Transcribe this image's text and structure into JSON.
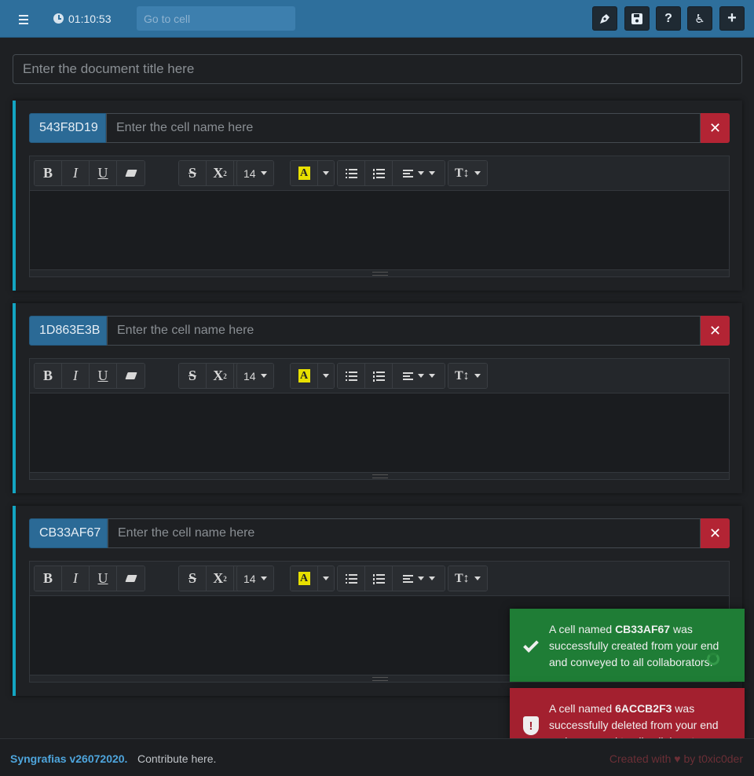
{
  "navbar": {
    "timer": "01:10:53",
    "goto_placeholder": "Go to cell",
    "buttons": [
      {
        "icon": "pen-nib-icon"
      },
      {
        "icon": "save-icon"
      },
      {
        "icon": "help-icon",
        "label": "?"
      },
      {
        "icon": "accessibility-icon",
        "label": "♿"
      },
      {
        "icon": "plus-icon",
        "label": "+"
      }
    ]
  },
  "document": {
    "title_placeholder": "Enter the document title here"
  },
  "cells": [
    {
      "id": "543F8D19",
      "name_placeholder": "Enter the cell name here",
      "font_size": "14",
      "delete_label": "✕"
    },
    {
      "id": "1D863E3B",
      "name_placeholder": "Enter the cell name here",
      "font_size": "14",
      "delete_label": "✕"
    },
    {
      "id": "CB33AF67",
      "name_placeholder": "Enter the cell name here",
      "font_size": "14",
      "delete_label": "✕"
    }
  ],
  "toolbar": {
    "bold": "B",
    "italic": "I",
    "underline": "U",
    "strike": "S",
    "superscript": "X",
    "sup_mark": "2",
    "subscript": "X",
    "sub_mark": "2",
    "highlight": "A",
    "line_height": "T↕"
  },
  "toasts": [
    {
      "type": "success",
      "prefix": "A cell named ",
      "cell": "CB33AF67",
      "suffix": " was successfully created from your end and conveyed to all collaborators."
    },
    {
      "type": "error",
      "prefix": "A cell named ",
      "cell": "6ACCB2F3",
      "suffix": " was successfully deleted from your end and conveyed to all collaborators."
    }
  ],
  "footer": {
    "brand": "Syngrafias v26072020.",
    "contribute": "Contribute here.",
    "credit": "Created with ♥ by t0xic0der"
  },
  "colors": {
    "navbar": "#2e6f9c",
    "cell_accent": "#13a5c2",
    "delete": "#b32434",
    "success": "#1f7d36",
    "error": "#a3202f"
  }
}
